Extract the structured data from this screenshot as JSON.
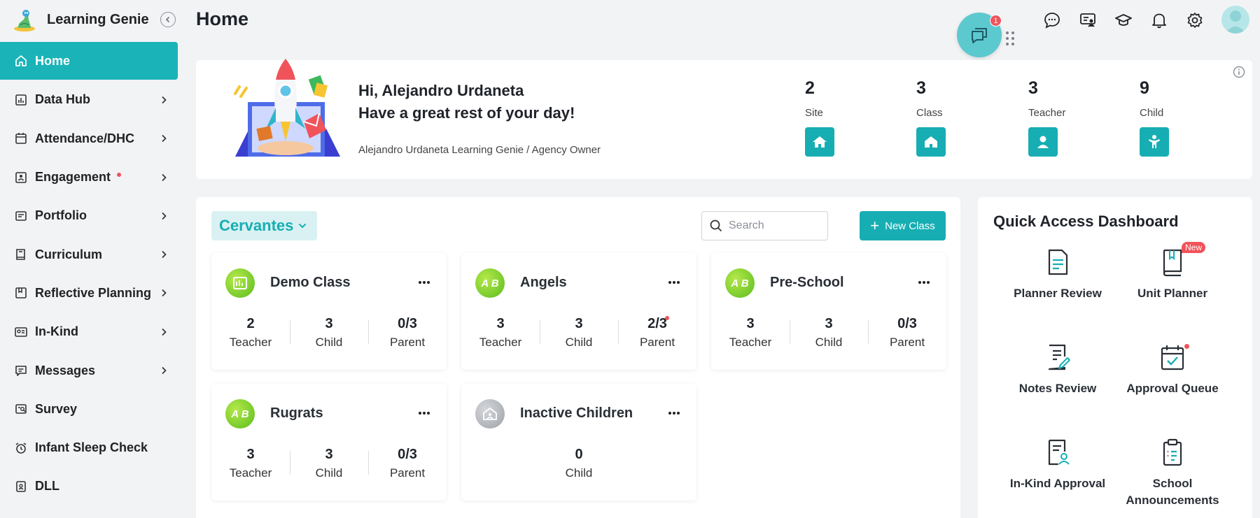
{
  "app": {
    "name": "Learning Genie",
    "page_title": "Home"
  },
  "sidebar": {
    "items": [
      {
        "label": "Home",
        "icon": "home-icon",
        "active": true
      },
      {
        "label": "Data Hub",
        "icon": "bar-chart-icon"
      },
      {
        "label": "Attendance/DHC",
        "icon": "calendar-icon"
      },
      {
        "label": "Engagement",
        "icon": "engagement-icon",
        "dot": true
      },
      {
        "label": "Portfolio",
        "icon": "portfolio-icon"
      },
      {
        "label": "Curriculum",
        "icon": "book-icon"
      },
      {
        "label": "Reflective Planning",
        "icon": "planning-icon"
      },
      {
        "label": "In-Kind",
        "icon": "in-kind-icon"
      },
      {
        "label": "Messages",
        "icon": "message-icon"
      },
      {
        "label": "Survey",
        "icon": "survey-icon"
      },
      {
        "label": "Infant Sleep Check",
        "icon": "alarm-clock-icon"
      },
      {
        "label": "DLL",
        "icon": "dll-icon"
      }
    ]
  },
  "header": {
    "chat_badge": "1",
    "icons": [
      "chat-bubble-icon",
      "presentation-icon",
      "graduation-cap-icon",
      "bell-icon",
      "gear-icon"
    ]
  },
  "welcome": {
    "greeting": "Hi, Alejandro Urdaneta",
    "message": "Have a great rest of your day!",
    "role": "Alejandro Urdaneta Learning Genie / Agency Owner",
    "stats": [
      {
        "value": "2",
        "label": "Site",
        "icon": "school-icon"
      },
      {
        "value": "3",
        "label": "Class",
        "icon": "house-icon"
      },
      {
        "value": "3",
        "label": "Teacher",
        "icon": "person-icon"
      },
      {
        "value": "9",
        "label": "Child",
        "icon": "child-icon"
      }
    ]
  },
  "classes": {
    "site": "Cervantes",
    "search_placeholder": "Search",
    "new_class_label": "New Class",
    "cards": [
      {
        "name": "Demo Class",
        "stats": [
          {
            "value": "2",
            "label": "Teacher"
          },
          {
            "value": "3",
            "label": "Child"
          },
          {
            "value": "0/3",
            "label": "Parent"
          }
        ]
      },
      {
        "name": "Angels",
        "stats": [
          {
            "value": "3",
            "label": "Teacher"
          },
          {
            "value": "3",
            "label": "Child"
          },
          {
            "value": "2/3",
            "label": "Parent",
            "dot": true
          }
        ]
      },
      {
        "name": "Pre-School",
        "stats": [
          {
            "value": "3",
            "label": "Teacher"
          },
          {
            "value": "3",
            "label": "Child"
          },
          {
            "value": "0/3",
            "label": "Parent"
          }
        ]
      },
      {
        "name": "Rugrats",
        "stats": [
          {
            "value": "3",
            "label": "Teacher"
          },
          {
            "value": "3",
            "label": "Child"
          },
          {
            "value": "0/3",
            "label": "Parent"
          }
        ]
      },
      {
        "name": "Inactive Children",
        "stats": [
          {
            "value": "0",
            "label": "Child"
          }
        ]
      }
    ],
    "class_icon_text": "A B"
  },
  "quick_access": {
    "title": "Quick Access Dashboard",
    "new_tag": "New",
    "items": [
      {
        "label": "Planner Review",
        "icon": "planner-review-icon"
      },
      {
        "label": "Unit Planner",
        "icon": "unit-planner-icon",
        "tag": "New"
      },
      {
        "label": "Notes Review",
        "icon": "notes-review-icon"
      },
      {
        "label": "Approval Queue",
        "icon": "approval-queue-icon",
        "dot": true
      },
      {
        "label": "In-Kind Approval",
        "icon": "in-kind-approval-icon"
      },
      {
        "label": "School Announcements",
        "icon": "clipboard-icon"
      }
    ]
  },
  "colors": {
    "accent": "#16aeb3",
    "accent_light": "#d9f1f2",
    "alert": "#f0535a",
    "page_bg": "#f2f3f5"
  }
}
